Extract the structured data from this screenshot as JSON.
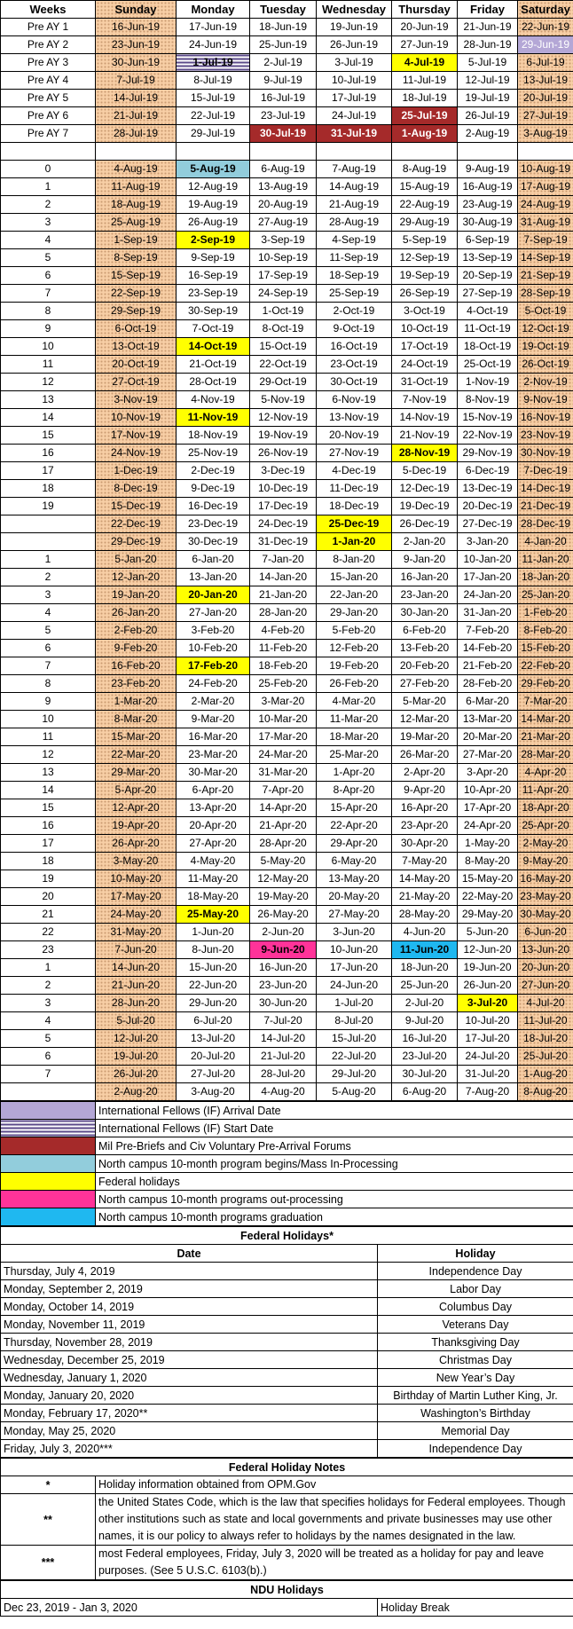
{
  "headers": [
    "Weeks",
    "Sunday",
    "Monday",
    "Tuesday",
    "Wednesday",
    "Thursday",
    "Friday",
    "Saturday"
  ],
  "calendar_rows": [
    {
      "week": "Pre AY 1",
      "days": [
        "16-Jun-19",
        "17-Jun-19",
        "18-Jun-19",
        "19-Jun-19",
        "20-Jun-19",
        "21-Jun-19",
        "22-Jun-19"
      ]
    },
    {
      "week": "Pre AY 2",
      "days": [
        "23-Jun-19",
        "24-Jun-19",
        "25-Jun-19",
        "26-Jun-19",
        "27-Jun-19",
        "28-Jun-19",
        "29-Jun-19"
      ],
      "hl": {
        "6": "purple"
      }
    },
    {
      "week": "Pre AY 3",
      "days": [
        "30-Jun-19",
        "1-Jul-19",
        "2-Jul-19",
        "3-Jul-19",
        "4-Jul-19",
        "5-Jul-19",
        "6-Jul-19"
      ],
      "hl": {
        "1": "stripe",
        "4": "yellow"
      }
    },
    {
      "week": "Pre AY 4",
      "days": [
        "7-Jul-19",
        "8-Jul-19",
        "9-Jul-19",
        "10-Jul-19",
        "11-Jul-19",
        "12-Jul-19",
        "13-Jul-19"
      ]
    },
    {
      "week": "Pre AY 5",
      "days": [
        "14-Jul-19",
        "15-Jul-19",
        "16-Jul-19",
        "17-Jul-19",
        "18-Jul-19",
        "19-Jul-19",
        "20-Jul-19"
      ]
    },
    {
      "week": "Pre AY 6",
      "days": [
        "21-Jul-19",
        "22-Jul-19",
        "23-Jul-19",
        "24-Jul-19",
        "25-Jul-19",
        "26-Jul-19",
        "27-Jul-19"
      ],
      "hl": {
        "4": "red"
      }
    },
    {
      "week": "Pre AY 7",
      "days": [
        "28-Jul-19",
        "29-Jul-19",
        "30-Jul-19",
        "31-Jul-19",
        "1-Aug-19",
        "2-Aug-19",
        "3-Aug-19"
      ],
      "hl": {
        "2": "red",
        "3": "red",
        "4": "red"
      }
    },
    {
      "week": "",
      "days": [
        "",
        "",
        "",
        "",
        "",
        "",
        ""
      ],
      "gap": true
    },
    {
      "week": "0",
      "days": [
        "4-Aug-19",
        "5-Aug-19",
        "6-Aug-19",
        "7-Aug-19",
        "8-Aug-19",
        "9-Aug-19",
        "10-Aug-19"
      ],
      "hl": {
        "1": "lblue"
      }
    },
    {
      "week": "1",
      "days": [
        "11-Aug-19",
        "12-Aug-19",
        "13-Aug-19",
        "14-Aug-19",
        "15-Aug-19",
        "16-Aug-19",
        "17-Aug-19"
      ]
    },
    {
      "week": "2",
      "days": [
        "18-Aug-19",
        "19-Aug-19",
        "20-Aug-19",
        "21-Aug-19",
        "22-Aug-19",
        "23-Aug-19",
        "24-Aug-19"
      ]
    },
    {
      "week": "3",
      "days": [
        "25-Aug-19",
        "26-Aug-19",
        "27-Aug-19",
        "28-Aug-19",
        "29-Aug-19",
        "30-Aug-19",
        "31-Aug-19"
      ]
    },
    {
      "week": "4",
      "days": [
        "1-Sep-19",
        "2-Sep-19",
        "3-Sep-19",
        "4-Sep-19",
        "5-Sep-19",
        "6-Sep-19",
        "7-Sep-19"
      ],
      "hl": {
        "1": "yellow"
      }
    },
    {
      "week": "5",
      "days": [
        "8-Sep-19",
        "9-Sep-19",
        "10-Sep-19",
        "11-Sep-19",
        "12-Sep-19",
        "13-Sep-19",
        "14-Sep-19"
      ]
    },
    {
      "week": "6",
      "days": [
        "15-Sep-19",
        "16-Sep-19",
        "17-Sep-19",
        "18-Sep-19",
        "19-Sep-19",
        "20-Sep-19",
        "21-Sep-19"
      ]
    },
    {
      "week": "7",
      "days": [
        "22-Sep-19",
        "23-Sep-19",
        "24-Sep-19",
        "25-Sep-19",
        "26-Sep-19",
        "27-Sep-19",
        "28-Sep-19"
      ]
    },
    {
      "week": "8",
      "days": [
        "29-Sep-19",
        "30-Sep-19",
        "1-Oct-19",
        "2-Oct-19",
        "3-Oct-19",
        "4-Oct-19",
        "5-Oct-19"
      ]
    },
    {
      "week": "9",
      "days": [
        "6-Oct-19",
        "7-Oct-19",
        "8-Oct-19",
        "9-Oct-19",
        "10-Oct-19",
        "11-Oct-19",
        "12-Oct-19"
      ]
    },
    {
      "week": "10",
      "days": [
        "13-Oct-19",
        "14-Oct-19",
        "15-Oct-19",
        "16-Oct-19",
        "17-Oct-19",
        "18-Oct-19",
        "19-Oct-19"
      ],
      "hl": {
        "1": "yellow"
      }
    },
    {
      "week": "11",
      "days": [
        "20-Oct-19",
        "21-Oct-19",
        "22-Oct-19",
        "23-Oct-19",
        "24-Oct-19",
        "25-Oct-19",
        "26-Oct-19"
      ]
    },
    {
      "week": "12",
      "days": [
        "27-Oct-19",
        "28-Oct-19",
        "29-Oct-19",
        "30-Oct-19",
        "31-Oct-19",
        "1-Nov-19",
        "2-Nov-19"
      ]
    },
    {
      "week": "13",
      "days": [
        "3-Nov-19",
        "4-Nov-19",
        "5-Nov-19",
        "6-Nov-19",
        "7-Nov-19",
        "8-Nov-19",
        "9-Nov-19"
      ]
    },
    {
      "week": "14",
      "days": [
        "10-Nov-19",
        "11-Nov-19",
        "12-Nov-19",
        "13-Nov-19",
        "14-Nov-19",
        "15-Nov-19",
        "16-Nov-19"
      ],
      "hl": {
        "1": "yellow"
      }
    },
    {
      "week": "15",
      "days": [
        "17-Nov-19",
        "18-Nov-19",
        "19-Nov-19",
        "20-Nov-19",
        "21-Nov-19",
        "22-Nov-19",
        "23-Nov-19"
      ]
    },
    {
      "week": "16",
      "days": [
        "24-Nov-19",
        "25-Nov-19",
        "26-Nov-19",
        "27-Nov-19",
        "28-Nov-19",
        "29-Nov-19",
        "30-Nov-19"
      ],
      "hl": {
        "4": "yellow"
      }
    },
    {
      "week": "17",
      "days": [
        "1-Dec-19",
        "2-Dec-19",
        "3-Dec-19",
        "4-Dec-19",
        "5-Dec-19",
        "6-Dec-19",
        "7-Dec-19"
      ]
    },
    {
      "week": "18",
      "days": [
        "8-Dec-19",
        "9-Dec-19",
        "10-Dec-19",
        "11-Dec-19",
        "12-Dec-19",
        "13-Dec-19",
        "14-Dec-19"
      ]
    },
    {
      "week": "19",
      "days": [
        "15-Dec-19",
        "16-Dec-19",
        "17-Dec-19",
        "18-Dec-19",
        "19-Dec-19",
        "20-Dec-19",
        "21-Dec-19"
      ]
    },
    {
      "week": "",
      "days": [
        "22-Dec-19",
        "23-Dec-19",
        "24-Dec-19",
        "25-Dec-19",
        "26-Dec-19",
        "27-Dec-19",
        "28-Dec-19"
      ],
      "hl": {
        "3": "yellow"
      }
    },
    {
      "week": "",
      "days": [
        "29-Dec-19",
        "30-Dec-19",
        "31-Dec-19",
        "1-Jan-20",
        "2-Jan-20",
        "3-Jan-20",
        "4-Jan-20"
      ],
      "hl": {
        "3": "yellow"
      }
    },
    {
      "week": "1",
      "days": [
        "5-Jan-20",
        "6-Jan-20",
        "7-Jan-20",
        "8-Jan-20",
        "9-Jan-20",
        "10-Jan-20",
        "11-Jan-20"
      ]
    },
    {
      "week": "2",
      "days": [
        "12-Jan-20",
        "13-Jan-20",
        "14-Jan-20",
        "15-Jan-20",
        "16-Jan-20",
        "17-Jan-20",
        "18-Jan-20"
      ]
    },
    {
      "week": "3",
      "days": [
        "19-Jan-20",
        "20-Jan-20",
        "21-Jan-20",
        "22-Jan-20",
        "23-Jan-20",
        "24-Jan-20",
        "25-Jan-20"
      ],
      "hl": {
        "1": "yellow"
      }
    },
    {
      "week": "4",
      "days": [
        "26-Jan-20",
        "27-Jan-20",
        "28-Jan-20",
        "29-Jan-20",
        "30-Jan-20",
        "31-Jan-20",
        "1-Feb-20"
      ]
    },
    {
      "week": "5",
      "days": [
        "2-Feb-20",
        "3-Feb-20",
        "4-Feb-20",
        "5-Feb-20",
        "6-Feb-20",
        "7-Feb-20",
        "8-Feb-20"
      ]
    },
    {
      "week": "6",
      "days": [
        "9-Feb-20",
        "10-Feb-20",
        "11-Feb-20",
        "12-Feb-20",
        "13-Feb-20",
        "14-Feb-20",
        "15-Feb-20"
      ]
    },
    {
      "week": "7",
      "days": [
        "16-Feb-20",
        "17-Feb-20",
        "18-Feb-20",
        "19-Feb-20",
        "20-Feb-20",
        "21-Feb-20",
        "22-Feb-20"
      ],
      "hl": {
        "1": "yellow"
      }
    },
    {
      "week": "8",
      "days": [
        "23-Feb-20",
        "24-Feb-20",
        "25-Feb-20",
        "26-Feb-20",
        "27-Feb-20",
        "28-Feb-20",
        "29-Feb-20"
      ]
    },
    {
      "week": "9",
      "days": [
        "1-Mar-20",
        "2-Mar-20",
        "3-Mar-20",
        "4-Mar-20",
        "5-Mar-20",
        "6-Mar-20",
        "7-Mar-20"
      ]
    },
    {
      "week": "10",
      "days": [
        "8-Mar-20",
        "9-Mar-20",
        "10-Mar-20",
        "11-Mar-20",
        "12-Mar-20",
        "13-Mar-20",
        "14-Mar-20"
      ]
    },
    {
      "week": "11",
      "days": [
        "15-Mar-20",
        "16-Mar-20",
        "17-Mar-20",
        "18-Mar-20",
        "19-Mar-20",
        "20-Mar-20",
        "21-Mar-20"
      ]
    },
    {
      "week": "12",
      "days": [
        "22-Mar-20",
        "23-Mar-20",
        "24-Mar-20",
        "25-Mar-20",
        "26-Mar-20",
        "27-Mar-20",
        "28-Mar-20"
      ]
    },
    {
      "week": "13",
      "days": [
        "29-Mar-20",
        "30-Mar-20",
        "31-Mar-20",
        "1-Apr-20",
        "2-Apr-20",
        "3-Apr-20",
        "4-Apr-20"
      ]
    },
    {
      "week": "14",
      "days": [
        "5-Apr-20",
        "6-Apr-20",
        "7-Apr-20",
        "8-Apr-20",
        "9-Apr-20",
        "10-Apr-20",
        "11-Apr-20"
      ]
    },
    {
      "week": "15",
      "days": [
        "12-Apr-20",
        "13-Apr-20",
        "14-Apr-20",
        "15-Apr-20",
        "16-Apr-20",
        "17-Apr-20",
        "18-Apr-20"
      ]
    },
    {
      "week": "16",
      "days": [
        "19-Apr-20",
        "20-Apr-20",
        "21-Apr-20",
        "22-Apr-20",
        "23-Apr-20",
        "24-Apr-20",
        "25-Apr-20"
      ]
    },
    {
      "week": "17",
      "days": [
        "26-Apr-20",
        "27-Apr-20",
        "28-Apr-20",
        "29-Apr-20",
        "30-Apr-20",
        "1-May-20",
        "2-May-20"
      ]
    },
    {
      "week": "18",
      "days": [
        "3-May-20",
        "4-May-20",
        "5-May-20",
        "6-May-20",
        "7-May-20",
        "8-May-20",
        "9-May-20"
      ]
    },
    {
      "week": "19",
      "days": [
        "10-May-20",
        "11-May-20",
        "12-May-20",
        "13-May-20",
        "14-May-20",
        "15-May-20",
        "16-May-20"
      ]
    },
    {
      "week": "20",
      "days": [
        "17-May-20",
        "18-May-20",
        "19-May-20",
        "20-May-20",
        "21-May-20",
        "22-May-20",
        "23-May-20"
      ]
    },
    {
      "week": "21",
      "days": [
        "24-May-20",
        "25-May-20",
        "26-May-20",
        "27-May-20",
        "28-May-20",
        "29-May-20",
        "30-May-20"
      ],
      "hl": {
        "1": "yellow"
      }
    },
    {
      "week": "22",
      "days": [
        "31-May-20",
        "1-Jun-20",
        "2-Jun-20",
        "3-Jun-20",
        "4-Jun-20",
        "5-Jun-20",
        "6-Jun-20"
      ]
    },
    {
      "week": "23",
      "days": [
        "7-Jun-20",
        "8-Jun-20",
        "9-Jun-20",
        "10-Jun-20",
        "11-Jun-20",
        "12-Jun-20",
        "13-Jun-20"
      ],
      "hl": {
        "2": "pink",
        "4": "blue"
      }
    },
    {
      "week": "1",
      "days": [
        "14-Jun-20",
        "15-Jun-20",
        "16-Jun-20",
        "17-Jun-20",
        "18-Jun-20",
        "19-Jun-20",
        "20-Jun-20"
      ]
    },
    {
      "week": "2",
      "days": [
        "21-Jun-20",
        "22-Jun-20",
        "23-Jun-20",
        "24-Jun-20",
        "25-Jun-20",
        "26-Jun-20",
        "27-Jun-20"
      ]
    },
    {
      "week": "3",
      "days": [
        "28-Jun-20",
        "29-Jun-20",
        "30-Jun-20",
        "1-Jul-20",
        "2-Jul-20",
        "3-Jul-20",
        "4-Jul-20"
      ],
      "hl": {
        "5": "yellow"
      }
    },
    {
      "week": "4",
      "days": [
        "5-Jul-20",
        "6-Jul-20",
        "7-Jul-20",
        "8-Jul-20",
        "9-Jul-20",
        "10-Jul-20",
        "11-Jul-20"
      ]
    },
    {
      "week": "5",
      "days": [
        "12-Jul-20",
        "13-Jul-20",
        "14-Jul-20",
        "15-Jul-20",
        "16-Jul-20",
        "17-Jul-20",
        "18-Jul-20"
      ]
    },
    {
      "week": "6",
      "days": [
        "19-Jul-20",
        "20-Jul-20",
        "21-Jul-20",
        "22-Jul-20",
        "23-Jul-20",
        "24-Jul-20",
        "25-Jul-20"
      ]
    },
    {
      "week": "7",
      "days": [
        "26-Jul-20",
        "27-Jul-20",
        "28-Jul-20",
        "29-Jul-20",
        "30-Jul-20",
        "31-Jul-20",
        "1-Aug-20"
      ]
    },
    {
      "week": "",
      "days": [
        "2-Aug-20",
        "3-Aug-20",
        "4-Aug-20",
        "5-Aug-20",
        "6-Aug-20",
        "7-Aug-20",
        "8-Aug-20"
      ]
    }
  ],
  "legend": [
    {
      "swatch": "purple",
      "label": "International Fellows (IF) Arrival Date"
    },
    {
      "swatch": "stripe",
      "label": "International Fellows (IF) Start Date"
    },
    {
      "swatch": "red",
      "label": "Mil Pre-Briefs and Civ Voluntary Pre-Arrival Forums"
    },
    {
      "swatch": "lblue",
      "label": "North campus 10-month program begins/Mass In-Processing"
    },
    {
      "swatch": "yellow",
      "label": "Federal holidays"
    },
    {
      "swatch": "pink",
      "label": "North campus 10-month programs out-processing"
    },
    {
      "swatch": "blue",
      "label": "North campus 10-month programs graduation"
    }
  ],
  "federal_holidays": {
    "title": "Federal Holidays*",
    "col_date": "Date",
    "col_holiday": "Holiday",
    "rows": [
      {
        "date": "Thursday, July 4, 2019",
        "holiday": "Independence Day"
      },
      {
        "date": "Monday, September 2, 2019",
        "holiday": "Labor Day"
      },
      {
        "date": "Monday, October 14, 2019",
        "holiday": "Columbus Day"
      },
      {
        "date": "Monday, November 11, 2019",
        "holiday": "Veterans Day"
      },
      {
        "date": "Thursday, November 28, 2019",
        "holiday": "Thanksgiving Day"
      },
      {
        "date": "Wednesday, December 25, 2019",
        "holiday": "Christmas Day"
      },
      {
        "date": "Wednesday, January 1, 2020",
        "holiday": "New Year’s Day"
      },
      {
        "date": "Monday, January 20, 2020",
        "holiday": "Birthday of Martin Luther King, Jr."
      },
      {
        "date": "Monday, February 17, 2020**",
        "holiday": "Washington’s Birthday"
      },
      {
        "date": "Monday, May 25, 2020",
        "holiday": "Memorial Day"
      },
      {
        "date": "Friday, July 3, 2020***",
        "holiday": "Independence Day"
      }
    ]
  },
  "holiday_notes": {
    "title": "Federal Holiday Notes",
    "rows": [
      {
        "mark": "*",
        "text": "Holiday information obtained from OPM.Gov"
      },
      {
        "mark": "**",
        "text": "the United States Code, which is the law that specifies holidays for Federal employees. Though other institutions such as state and local governments and private businesses may use other names, it is our policy to always refer to holidays by the names designated in the law."
      },
      {
        "mark": "***",
        "text": "most Federal employees, Friday, July 3, 2020 will be treated as a holiday for pay and leave purposes. (See 5 U.S.C. 6103(b).)"
      }
    ]
  },
  "ndu_holidays": {
    "title": "NDU Holidays",
    "rows": [
      {
        "date": "Dec 23, 2019 - Jan 3, 2020",
        "holiday": "Holiday Break"
      }
    ]
  }
}
